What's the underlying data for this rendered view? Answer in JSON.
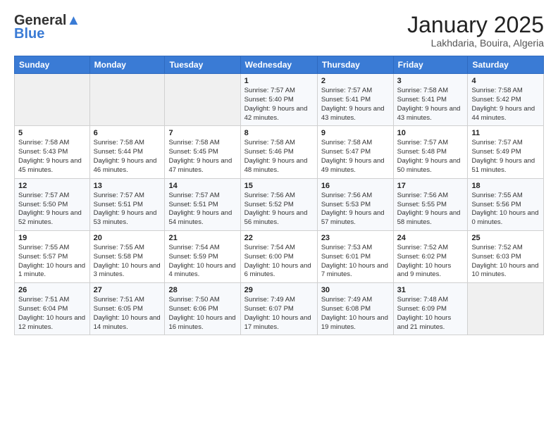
{
  "header": {
    "logo_line1": "General",
    "logo_line2": "Blue",
    "month": "January 2025",
    "location": "Lakhdaria, Bouira, Algeria"
  },
  "days_of_week": [
    "Sunday",
    "Monday",
    "Tuesday",
    "Wednesday",
    "Thursday",
    "Friday",
    "Saturday"
  ],
  "weeks": [
    [
      {
        "day": "",
        "info": ""
      },
      {
        "day": "",
        "info": ""
      },
      {
        "day": "",
        "info": ""
      },
      {
        "day": "1",
        "info": "Sunrise: 7:57 AM\nSunset: 5:40 PM\nDaylight: 9 hours and 42 minutes."
      },
      {
        "day": "2",
        "info": "Sunrise: 7:57 AM\nSunset: 5:41 PM\nDaylight: 9 hours and 43 minutes."
      },
      {
        "day": "3",
        "info": "Sunrise: 7:58 AM\nSunset: 5:41 PM\nDaylight: 9 hours and 43 minutes."
      },
      {
        "day": "4",
        "info": "Sunrise: 7:58 AM\nSunset: 5:42 PM\nDaylight: 9 hours and 44 minutes."
      }
    ],
    [
      {
        "day": "5",
        "info": "Sunrise: 7:58 AM\nSunset: 5:43 PM\nDaylight: 9 hours and 45 minutes."
      },
      {
        "day": "6",
        "info": "Sunrise: 7:58 AM\nSunset: 5:44 PM\nDaylight: 9 hours and 46 minutes."
      },
      {
        "day": "7",
        "info": "Sunrise: 7:58 AM\nSunset: 5:45 PM\nDaylight: 9 hours and 47 minutes."
      },
      {
        "day": "8",
        "info": "Sunrise: 7:58 AM\nSunset: 5:46 PM\nDaylight: 9 hours and 48 minutes."
      },
      {
        "day": "9",
        "info": "Sunrise: 7:58 AM\nSunset: 5:47 PM\nDaylight: 9 hours and 49 minutes."
      },
      {
        "day": "10",
        "info": "Sunrise: 7:57 AM\nSunset: 5:48 PM\nDaylight: 9 hours and 50 minutes."
      },
      {
        "day": "11",
        "info": "Sunrise: 7:57 AM\nSunset: 5:49 PM\nDaylight: 9 hours and 51 minutes."
      }
    ],
    [
      {
        "day": "12",
        "info": "Sunrise: 7:57 AM\nSunset: 5:50 PM\nDaylight: 9 hours and 52 minutes."
      },
      {
        "day": "13",
        "info": "Sunrise: 7:57 AM\nSunset: 5:51 PM\nDaylight: 9 hours and 53 minutes."
      },
      {
        "day": "14",
        "info": "Sunrise: 7:57 AM\nSunset: 5:51 PM\nDaylight: 9 hours and 54 minutes."
      },
      {
        "day": "15",
        "info": "Sunrise: 7:56 AM\nSunset: 5:52 PM\nDaylight: 9 hours and 56 minutes."
      },
      {
        "day": "16",
        "info": "Sunrise: 7:56 AM\nSunset: 5:53 PM\nDaylight: 9 hours and 57 minutes."
      },
      {
        "day": "17",
        "info": "Sunrise: 7:56 AM\nSunset: 5:55 PM\nDaylight: 9 hours and 58 minutes."
      },
      {
        "day": "18",
        "info": "Sunrise: 7:55 AM\nSunset: 5:56 PM\nDaylight: 10 hours and 0 minutes."
      }
    ],
    [
      {
        "day": "19",
        "info": "Sunrise: 7:55 AM\nSunset: 5:57 PM\nDaylight: 10 hours and 1 minute."
      },
      {
        "day": "20",
        "info": "Sunrise: 7:55 AM\nSunset: 5:58 PM\nDaylight: 10 hours and 3 minutes."
      },
      {
        "day": "21",
        "info": "Sunrise: 7:54 AM\nSunset: 5:59 PM\nDaylight: 10 hours and 4 minutes."
      },
      {
        "day": "22",
        "info": "Sunrise: 7:54 AM\nSunset: 6:00 PM\nDaylight: 10 hours and 6 minutes."
      },
      {
        "day": "23",
        "info": "Sunrise: 7:53 AM\nSunset: 6:01 PM\nDaylight: 10 hours and 7 minutes."
      },
      {
        "day": "24",
        "info": "Sunrise: 7:52 AM\nSunset: 6:02 PM\nDaylight: 10 hours and 9 minutes."
      },
      {
        "day": "25",
        "info": "Sunrise: 7:52 AM\nSunset: 6:03 PM\nDaylight: 10 hours and 10 minutes."
      }
    ],
    [
      {
        "day": "26",
        "info": "Sunrise: 7:51 AM\nSunset: 6:04 PM\nDaylight: 10 hours and 12 minutes."
      },
      {
        "day": "27",
        "info": "Sunrise: 7:51 AM\nSunset: 6:05 PM\nDaylight: 10 hours and 14 minutes."
      },
      {
        "day": "28",
        "info": "Sunrise: 7:50 AM\nSunset: 6:06 PM\nDaylight: 10 hours and 16 minutes."
      },
      {
        "day": "29",
        "info": "Sunrise: 7:49 AM\nSunset: 6:07 PM\nDaylight: 10 hours and 17 minutes."
      },
      {
        "day": "30",
        "info": "Sunrise: 7:49 AM\nSunset: 6:08 PM\nDaylight: 10 hours and 19 minutes."
      },
      {
        "day": "31",
        "info": "Sunrise: 7:48 AM\nSunset: 6:09 PM\nDaylight: 10 hours and 21 minutes."
      },
      {
        "day": "",
        "info": ""
      }
    ]
  ]
}
